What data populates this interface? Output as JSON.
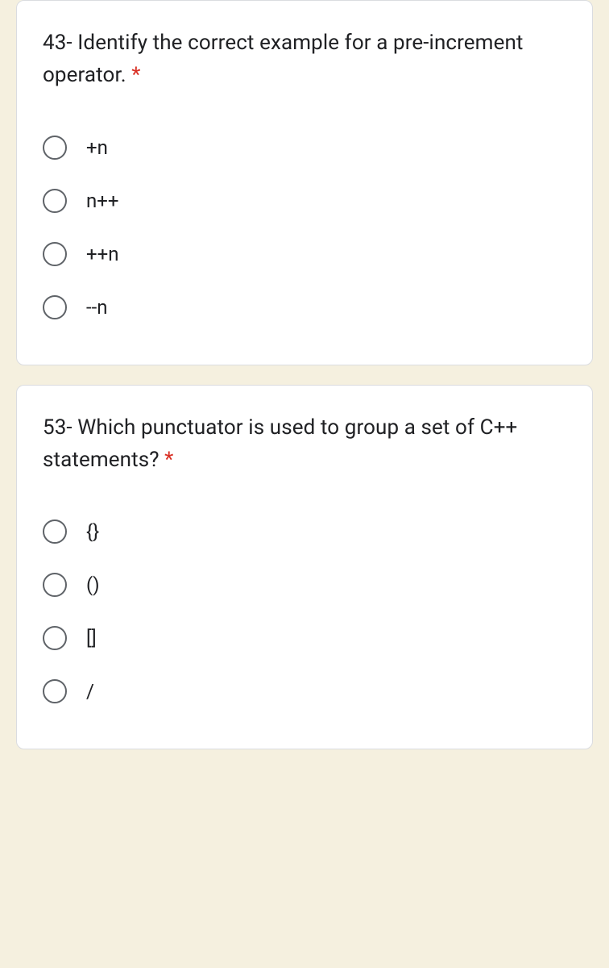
{
  "questions": [
    {
      "text": "43- Identify the correct example for a pre-increment operator. ",
      "required": "*",
      "options": [
        "+n",
        "n++",
        "++n",
        "--n"
      ]
    },
    {
      "text": "53- Which punctuator is used to group a set of C++ statements? ",
      "required": "*",
      "options": [
        "{}",
        "()",
        "[]",
        "/"
      ]
    }
  ]
}
